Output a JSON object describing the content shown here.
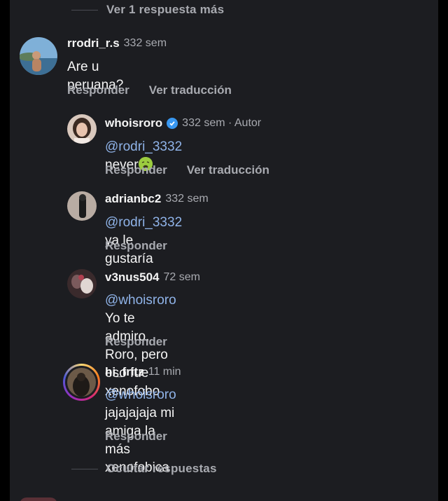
{
  "more_replies": "Ver 1 respuesta más",
  "hide_replies": "Ocultar respuestas",
  "comments": [
    {
      "username": "rrodri_r.s",
      "time": "332 sem",
      "text": "Are u peruana?",
      "reply": "Responder",
      "translate": "Ver traducción"
    },
    {
      "username": "whoisroro",
      "time": "332 sem · Autor",
      "mention": "@rodri_3332",
      "text": "never",
      "emoji": "nauseated-face-emoji",
      "reply": "Responder",
      "translate": "Ver traducción"
    },
    {
      "username": "adrianbc2",
      "time": "332 sem",
      "mention": "@rodri_3332",
      "text": "ya le gustaría",
      "reply": "Responder"
    },
    {
      "username": "v3nus504",
      "time": "72 sem",
      "mention": "@whoisroro",
      "text_line1": "Yo te admiro, Roro, pero eso fue",
      "text_line2": "xenofobo",
      "reply": "Responder"
    },
    {
      "username": "hi_fritz",
      "time": "11 min",
      "mention": "@whoisroro",
      "text_line1": "jajajajaja mi amiga la más",
      "text_line2": "xenofobica",
      "reply": "Responder"
    }
  ],
  "colors": {
    "background": "#1c1d21",
    "mention": "#8fb3e8",
    "secondary_text": "#a8aab0",
    "verified": "#3897f0"
  }
}
